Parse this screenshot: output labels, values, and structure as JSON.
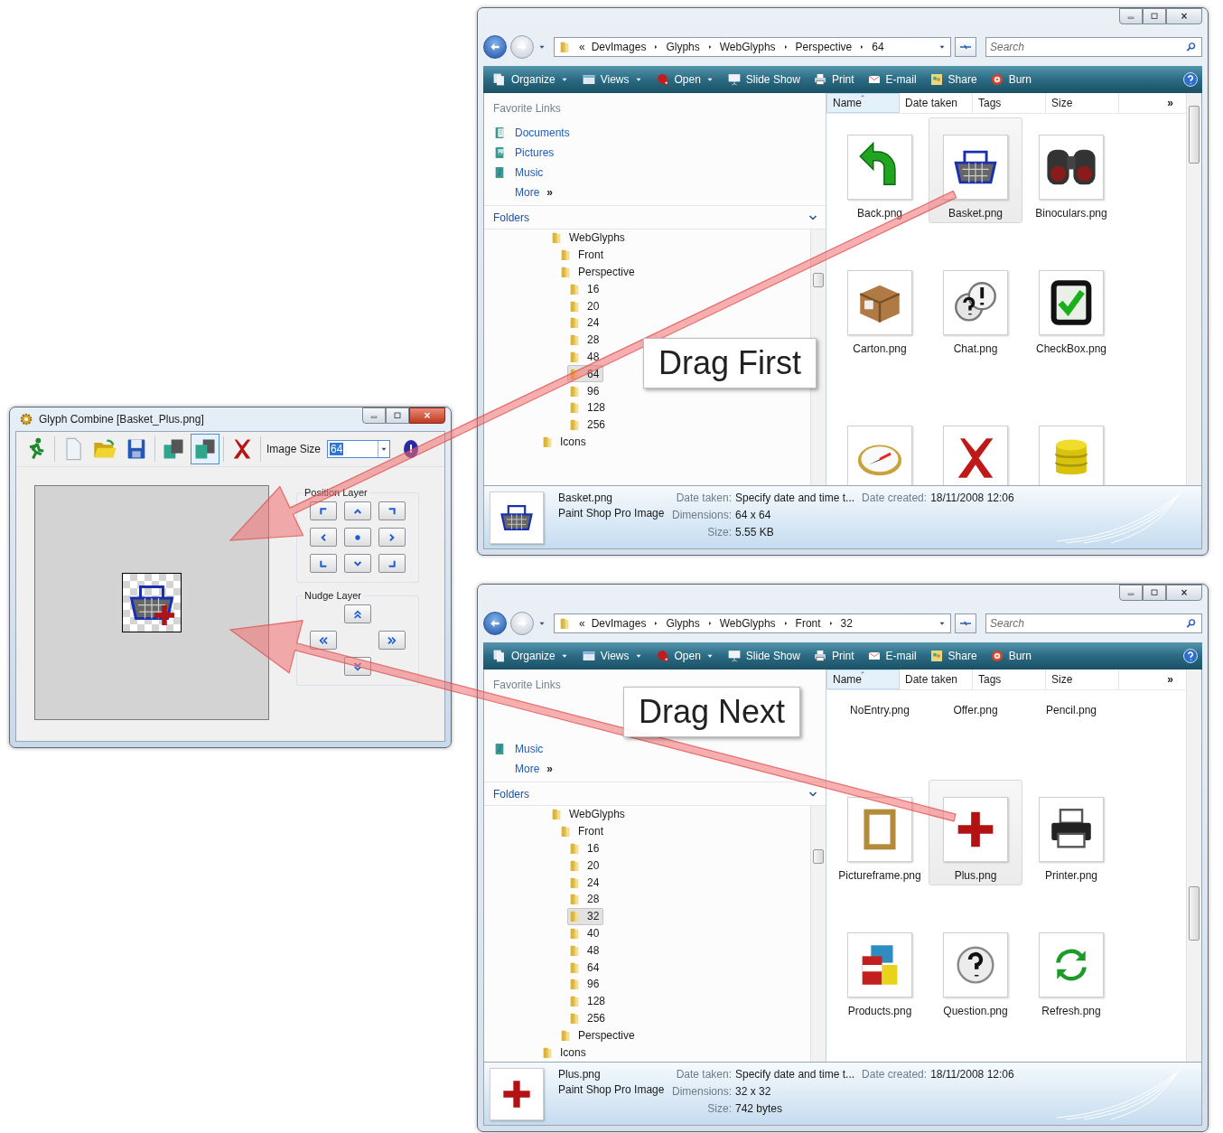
{
  "glyph_window": {
    "title": "Glyph Combine [Basket_Plus.png]",
    "tool_groups": [
      [
        {
          "kind": "runner",
          "selected": false
        }
      ],
      [
        {
          "kind": "new",
          "selected": false
        },
        {
          "kind": "open",
          "selected": false
        },
        {
          "kind": "save",
          "selected": false
        }
      ],
      [
        {
          "kind": "layer-back",
          "selected": false
        },
        {
          "kind": "layer-front",
          "selected": true
        }
      ],
      [
        {
          "kind": "delete",
          "selected": false
        }
      ]
    ],
    "size_label": "Image Size",
    "size_value": "64",
    "position_group": {
      "title": "Position Layer",
      "buttons": [
        {
          "kind": "top-left"
        },
        {
          "kind": "up"
        },
        {
          "kind": "top-right"
        },
        {
          "kind": "left"
        },
        {
          "kind": "center"
        },
        {
          "kind": "right"
        },
        {
          "kind": "bottom-left"
        },
        {
          "kind": "down"
        },
        {
          "kind": "bottom-right"
        }
      ]
    },
    "nudge_group": {
      "title": "Nudge Layer",
      "buttons": [
        {
          "kind": "up2"
        },
        {
          "kind": "left2"
        },
        {
          "kind": "right2"
        },
        {
          "kind": "down2"
        }
      ]
    }
  },
  "explorers": [
    {
      "address": {
        "overflow": "«",
        "crumbs": [
          "DevImages",
          "Glyphs",
          "WebGlyphs",
          "Perspective",
          "64"
        ]
      },
      "search": {
        "placeholder": "Search"
      },
      "toolbar": [
        {
          "label": "Organize",
          "kind": "organize",
          "menu": true
        },
        {
          "label": "Views",
          "kind": "views",
          "menu": true
        },
        {
          "label": "Open",
          "kind": "open",
          "menu": true
        },
        {
          "label": "Slide Show",
          "kind": "slideshow",
          "menu": false
        },
        {
          "label": "Print",
          "kind": "print",
          "menu": false
        },
        {
          "label": "E-mail",
          "kind": "email",
          "menu": false
        },
        {
          "label": "Share",
          "kind": "share",
          "menu": false
        },
        {
          "label": "Burn",
          "kind": "burn",
          "menu": false
        }
      ],
      "favorites": {
        "title": "Favorite Links",
        "links": [
          {
            "label": "Documents",
            "kind": "documents"
          },
          {
            "label": "Pictures",
            "kind": "pictures"
          },
          {
            "label": "Music",
            "kind": "music"
          },
          {
            "label": "More",
            "kind": "more",
            "mark": "»"
          }
        ]
      },
      "folders": {
        "title": "Folders",
        "tree": [
          {
            "children": [
              {
                "label": "WebGlyphs",
                "selected": false,
                "children": [
                  {
                    "label": "Front",
                    "selected": false
                  },
                  {
                    "label": "Perspective",
                    "selected": false,
                    "children": [
                      {
                        "label": "16",
                        "selected": false
                      },
                      {
                        "label": "20",
                        "selected": false
                      },
                      {
                        "label": "24",
                        "selected": false
                      },
                      {
                        "label": "28",
                        "selected": false
                      },
                      {
                        "label": "48",
                        "selected": false
                      },
                      {
                        "label": "64",
                        "selected": true
                      },
                      {
                        "label": "96",
                        "selected": false
                      },
                      {
                        "label": "128",
                        "selected": false
                      },
                      {
                        "label": "256",
                        "selected": false
                      }
                    ]
                  }
                ]
              }
            ]
          },
          {
            "label": "Icons",
            "selected": false
          }
        ]
      },
      "columns": [
        {
          "label": "Name",
          "sorted": true
        },
        {
          "label": "Date taken",
          "sorted": false
        },
        {
          "label": "Tags",
          "sorted": false
        },
        {
          "label": "Size",
          "sorted": false
        }
      ],
      "columns_more": "»",
      "items": [
        {
          "name": "Back.png",
          "kind": "arrow",
          "selected": false
        },
        {
          "name": "Basket.png",
          "kind": "basket",
          "selected": true
        },
        {
          "name": "Binoculars.png",
          "kind": "binoculars",
          "selected": false
        },
        {
          "name": "Carton.png",
          "kind": "carton",
          "selected": false
        },
        {
          "name": "Chat.png",
          "kind": "chat",
          "selected": false
        },
        {
          "name": "CheckBox.png",
          "kind": "checkbox",
          "selected": false
        },
        {
          "kind": "compass",
          "selected": false
        },
        {
          "kind": "cross",
          "selected": false
        },
        {
          "kind": "database",
          "selected": false
        }
      ],
      "details": {
        "kind": "basket",
        "name": "Basket.png",
        "type": "Paint Shop Pro Image",
        "fields": [
          {
            "label": "Date taken:",
            "value": "Specify date and time t..."
          },
          {
            "label": "Dimensions:",
            "value": "64 x 64"
          },
          {
            "label": "Size:",
            "value": "5.55 KB"
          },
          {
            "label": "Date created:",
            "value": "18/11/2008 12:06"
          }
        ]
      }
    },
    {
      "address": {
        "overflow": "«",
        "crumbs": [
          "DevImages",
          "Glyphs",
          "WebGlyphs",
          "Front",
          "32"
        ]
      },
      "search": {
        "placeholder": "Search"
      },
      "toolbar": [
        {
          "label": "Organize",
          "kind": "organize",
          "menu": true
        },
        {
          "label": "Views",
          "kind": "views",
          "menu": true
        },
        {
          "label": "Open",
          "kind": "open",
          "menu": true
        },
        {
          "label": "Slide Show",
          "kind": "slideshow",
          "menu": false
        },
        {
          "label": "Print",
          "kind": "print",
          "menu": false
        },
        {
          "label": "E-mail",
          "kind": "email",
          "menu": false
        },
        {
          "label": "Share",
          "kind": "share",
          "menu": false
        },
        {
          "label": "Burn",
          "kind": "burn",
          "menu": false
        }
      ],
      "favorites": {
        "title": "Favorite Links",
        "links": [
          {
            "label": "Music",
            "kind": "music"
          },
          {
            "label": "More",
            "kind": "more",
            "mark": "»"
          }
        ]
      },
      "folders": {
        "title": "Folders",
        "tree": [
          {
            "children": [
              {
                "label": "WebGlyphs",
                "selected": false,
                "children": [
                  {
                    "label": "Front",
                    "selected": false,
                    "children": [
                      {
                        "label": "16",
                        "selected": false
                      },
                      {
                        "label": "20",
                        "selected": false
                      },
                      {
                        "label": "24",
                        "selected": false
                      },
                      {
                        "label": "28",
                        "selected": false
                      },
                      {
                        "label": "32",
                        "selected": true
                      },
                      {
                        "label": "40",
                        "selected": false
                      },
                      {
                        "label": "48",
                        "selected": false
                      },
                      {
                        "label": "64",
                        "selected": false
                      },
                      {
                        "label": "96",
                        "selected": false
                      },
                      {
                        "label": "128",
                        "selected": false
                      },
                      {
                        "label": "256",
                        "selected": false
                      }
                    ]
                  },
                  {
                    "label": "Perspective",
                    "selected": false
                  }
                ]
              }
            ]
          },
          {
            "label": "Icons",
            "selected": false
          }
        ]
      },
      "columns": [
        {
          "label": "Name",
          "sorted": true
        },
        {
          "label": "Date taken",
          "sorted": false
        },
        {
          "label": "Tags",
          "sorted": false
        },
        {
          "label": "Size",
          "sorted": false
        }
      ],
      "columns_more": "»",
      "items": [
        {
          "name": "NoEntry.png",
          "selected": false
        },
        {
          "name": "Offer.png",
          "selected": false
        },
        {
          "name": "Pencil.png",
          "selected": false
        },
        {
          "name": "Pictureframe.png",
          "kind": "frame",
          "selected": false
        },
        {
          "name": "Plus.png",
          "kind": "plus",
          "selected": true
        },
        {
          "name": "Printer.png",
          "kind": "printer",
          "selected": false
        },
        {
          "name": "Products.png",
          "kind": "products",
          "selected": false
        },
        {
          "name": "Question.png",
          "kind": "question",
          "selected": false
        },
        {
          "name": "Refresh.png",
          "kind": "refresh",
          "selected": false
        }
      ],
      "details": {
        "kind": "plus",
        "name": "Plus.png",
        "type": "Paint Shop Pro Image",
        "fields": [
          {
            "label": "Date taken:",
            "value": "Specify date and time t..."
          },
          {
            "label": "Dimensions:",
            "value": "32 x 32"
          },
          {
            "label": "Size:",
            "value": "742 bytes"
          },
          {
            "label": "Date created:",
            "value": "18/11/2008 12:06"
          }
        ]
      }
    }
  ],
  "callouts": [
    {
      "text": "Drag First"
    },
    {
      "text": "Drag Next"
    }
  ]
}
